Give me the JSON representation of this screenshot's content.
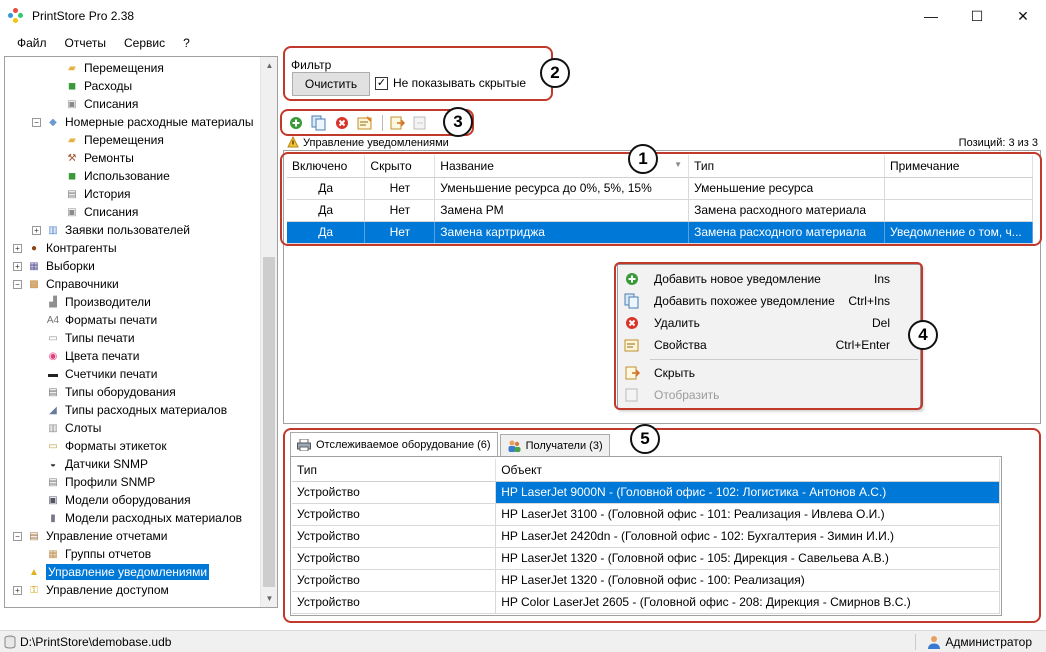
{
  "window": {
    "title": "PrintStore Pro 2.38",
    "minimize": "—",
    "maximize": "☐",
    "close": "✕"
  },
  "menu": [
    "Файл",
    "Отчеты",
    "Сервис",
    "?"
  ],
  "tree": {
    "items": [
      {
        "label": "Перемещения",
        "indent": 3,
        "icon": "folder-icon",
        "expander": ""
      },
      {
        "label": "Расходы",
        "indent": 3,
        "icon": "cart-icon",
        "expander": ""
      },
      {
        "label": "Списания",
        "indent": 3,
        "icon": "writeoff-icon",
        "expander": ""
      },
      {
        "label": "Номерные расходные материалы",
        "indent": 2,
        "icon": "consumable-icon",
        "expander": "−"
      },
      {
        "label": "Перемещения",
        "indent": 3,
        "icon": "folder-icon",
        "expander": ""
      },
      {
        "label": "Ремонты",
        "indent": 3,
        "icon": "hammer-icon",
        "expander": ""
      },
      {
        "label": "Использование",
        "indent": 3,
        "icon": "cart-icon",
        "expander": ""
      },
      {
        "label": "История",
        "indent": 3,
        "icon": "history-icon",
        "expander": ""
      },
      {
        "label": "Списания",
        "indent": 3,
        "icon": "writeoff-icon",
        "expander": ""
      },
      {
        "label": "Заявки пользователей",
        "indent": 2,
        "icon": "request-icon",
        "expander": "+"
      },
      {
        "label": "Контрагенты",
        "indent": 1,
        "icon": "contractor-icon",
        "expander": "+"
      },
      {
        "label": "Выборки",
        "indent": 1,
        "icon": "selection-icon",
        "expander": "+"
      },
      {
        "label": "Справочники",
        "indent": 1,
        "icon": "book-icon",
        "expander": "−"
      },
      {
        "label": "Производители",
        "indent": 2,
        "icon": "factory-icon",
        "expander": ""
      },
      {
        "label": "Форматы печати",
        "indent": 2,
        "icon": "paper-format-icon",
        "expander": ""
      },
      {
        "label": "Типы печати",
        "indent": 2,
        "icon": "print-type-icon",
        "expander": ""
      },
      {
        "label": "Цвета печати",
        "indent": 2,
        "icon": "color-wheel-icon",
        "expander": ""
      },
      {
        "label": "Счетчики печати",
        "indent": 2,
        "icon": "counter-icon",
        "expander": ""
      },
      {
        "label": "Типы оборудования",
        "indent": 2,
        "icon": "equipment-type-icon",
        "expander": ""
      },
      {
        "label": "Типы расходных материалов",
        "indent": 2,
        "icon": "consumable-type-icon",
        "expander": ""
      },
      {
        "label": "Слоты",
        "indent": 2,
        "icon": "slot-icon",
        "expander": ""
      },
      {
        "label": "Форматы этикеток",
        "indent": 2,
        "icon": "label-icon",
        "expander": ""
      },
      {
        "label": "Датчики SNMP",
        "indent": 2,
        "icon": "sensor-icon",
        "expander": ""
      },
      {
        "label": "Профили SNMP",
        "indent": 2,
        "icon": "profile-icon",
        "expander": ""
      },
      {
        "label": "Модели оборудования",
        "indent": 2,
        "icon": "printer-icon",
        "expander": ""
      },
      {
        "label": "Модели расходных материалов",
        "indent": 2,
        "icon": "cartridge-icon",
        "expander": ""
      },
      {
        "label": "Управление отчетами",
        "indent": 1,
        "icon": "report-icon",
        "expander": "−"
      },
      {
        "label": "Группы отчетов",
        "indent": 2,
        "icon": "report-group-icon",
        "expander": ""
      },
      {
        "label": "Управление уведомлениями",
        "indent": 1,
        "icon": "notification-icon",
        "expander": "",
        "selected": true
      },
      {
        "label": "Управление доступом",
        "indent": 1,
        "icon": "key-icon",
        "expander": "+"
      }
    ]
  },
  "filter": {
    "title": "Фильтр",
    "clear_button": "Очистить",
    "hide_checkbox_label": "Не показывать скрытые",
    "hide_checked": "✓"
  },
  "badges": [
    "1",
    "2",
    "3",
    "4",
    "5"
  ],
  "caption": "Управление уведомлениями",
  "positions": "Позиций: 3 из 3",
  "grid": {
    "columns": [
      "Включено",
      "Скрыто",
      "Название",
      "Тип",
      "Примечание"
    ],
    "rows": [
      {
        "enabled": "Да",
        "hidden": "Нет",
        "name": "Уменьшение ресурса до 0%, 5%, 15%",
        "type": "Уменьшение ресурса",
        "note": ""
      },
      {
        "enabled": "Да",
        "hidden": "Нет",
        "name": "Замена РМ",
        "type": "Замена расходного материала",
        "note": ""
      },
      {
        "enabled": "Да",
        "hidden": "Нет",
        "name": "Замена картриджа",
        "type": "Замена расходного материала",
        "note": "Уведомление о том, ч..."
      }
    ]
  },
  "context_menu": {
    "items": [
      {
        "label": "Добавить новое уведомление",
        "shortcut": "Ins"
      },
      {
        "label": "Добавить похожее уведомление",
        "shortcut": "Ctrl+Ins"
      },
      {
        "label": "Удалить",
        "shortcut": "Del"
      },
      {
        "label": "Свойства",
        "shortcut": "Ctrl+Enter"
      },
      {
        "label": "Скрыть",
        "shortcut": ""
      },
      {
        "label": "Отобразить",
        "shortcut": "",
        "disabled": true
      }
    ]
  },
  "bottom_tabs": [
    {
      "label": "Отслеживаемое оборудование (6)"
    },
    {
      "label": "Получатели (3)"
    }
  ],
  "equipment": {
    "columns": [
      "Тип",
      "Объект"
    ],
    "rows": [
      {
        "type": "Устройство",
        "object": "HP LaserJet 9000N - (Головной офис - 102: Логистика - Антонов А.С.)"
      },
      {
        "type": "Устройство",
        "object": "HP LaserJet 3100 - (Головной офис - 101: Реализация - Ивлева О.И.)"
      },
      {
        "type": "Устройство",
        "object": "HP LaserJet 2420dn - (Головной офис - 102: Бухгалтерия - Зимин И.И.)"
      },
      {
        "type": "Устройство",
        "object": "HP LaserJet 1320 - (Головной офис - 105: Дирекция - Савельева А.В.)"
      },
      {
        "type": "Устройство",
        "object": "HP LaserJet 1320 - (Головной офис - 100: Реализация)"
      },
      {
        "type": "Устройство",
        "object": "HP Color LaserJet 2605 - (Головной офис - 208: Дирекция - Смирнов В.С.)"
      }
    ]
  },
  "status": {
    "path": "D:\\PrintStore\\demobase.udb",
    "user": "Администратор"
  },
  "colors": {
    "selection": "#0078d7",
    "highlight_frame": "#c0392b"
  }
}
